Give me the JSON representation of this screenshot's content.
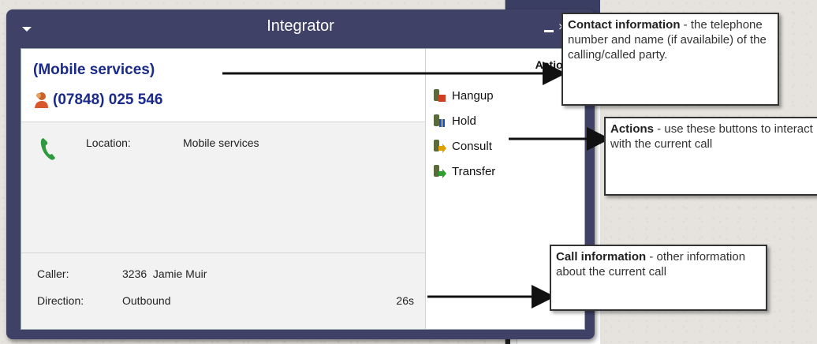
{
  "window": {
    "title": "Integrator",
    "close_glyph": "×"
  },
  "contact": {
    "name": "(Mobile services)",
    "number": "(07848) 025 546"
  },
  "details": {
    "location_label": "Location:",
    "location_value": "Mobile services"
  },
  "call": {
    "caller_label": "Caller:",
    "caller_value": "3236  Jamie Muir",
    "direction_label": "Direction:",
    "direction_value": "Outbound",
    "duration": "26s"
  },
  "actions": {
    "header": "Actions",
    "items": [
      {
        "label": "Hangup",
        "icon": "hangup-icon",
        "color": "#d04020"
      },
      {
        "label": "Hold",
        "icon": "hold-icon",
        "color": "#2050c0"
      },
      {
        "label": "Consult",
        "icon": "consult-icon",
        "color": "#e0a000"
      },
      {
        "label": "Transfer",
        "icon": "transfer-icon",
        "color": "#30a030"
      }
    ]
  },
  "callouts": {
    "contact": {
      "title": "Contact information",
      "text": " - the telephone number and name (if availabile) of the calling/called party."
    },
    "actions": {
      "title": "Actions",
      "text": " - use these buttons to interact with the current call"
    },
    "call": {
      "title": "Call information",
      "text": " - other information about the current call"
    }
  },
  "colors": {
    "titlebar": "#3f4166",
    "contact_text": "#1a2a8a",
    "phone": "#2e9a3e"
  }
}
